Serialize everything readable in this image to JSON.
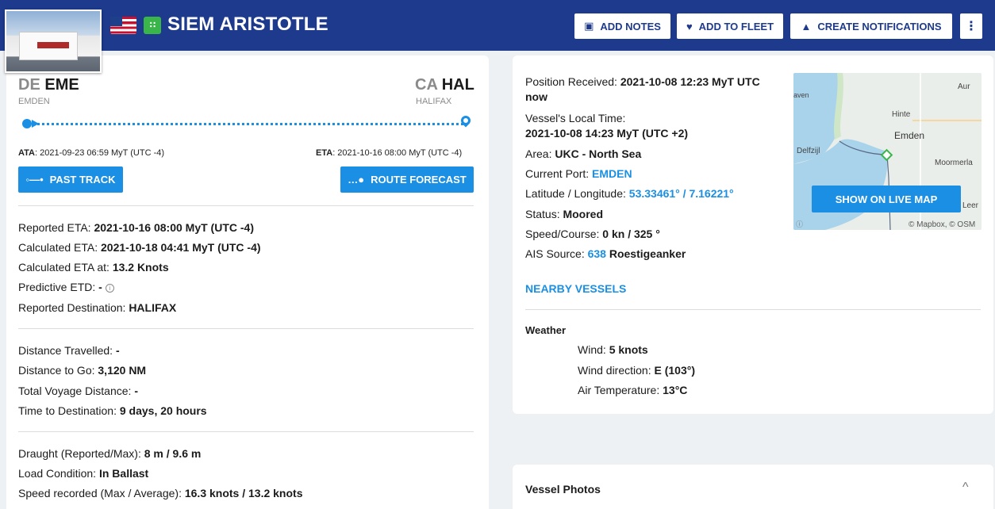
{
  "header": {
    "vessel_name": "SIEM ARISTOTLE",
    "flag_icon": "us-flag-icon",
    "type_icon": "cargo-vessel-icon",
    "buttons": {
      "add_notes": "ADD NOTES",
      "add_to_fleet": "ADD TO FLEET",
      "create_notifications": "CREATE NOTIFICATIONS"
    },
    "more_icon": "⋮",
    "color": "#1d3a8c"
  },
  "voyage": {
    "origin": {
      "country": "DE",
      "code": "EME",
      "name": "EMDEN"
    },
    "destination": {
      "country": "CA",
      "code": "HAL",
      "name": "HALIFAX"
    },
    "ata_label": "ATA",
    "ata_value": ": 2021-09-23 06:59 MyT (UTC -4)",
    "eta_label": "ETA",
    "eta_value": ": 2021-10-16 08:00 MyT (UTC -4)",
    "past_track_label": "PAST TRACK",
    "route_forecast_label": "ROUTE FORECAST",
    "accent": "#1a8fe3"
  },
  "eta_info": {
    "reported_eta": {
      "label": "Reported ETA: ",
      "value": "2021-10-16 08:00 MyT (UTC -4)"
    },
    "calculated_eta": {
      "label": "Calculated ETA: ",
      "value": "2021-10-18 04:41 MyT (UTC -4)"
    },
    "calculated_eta_at": {
      "label": "Calculated ETA at: ",
      "value": "13.2 Knots"
    },
    "predictive_etd": {
      "label": "Predictive ETD: ",
      "value": "-"
    },
    "reported_destination": {
      "label": "Reported Destination: ",
      "value": "HALIFAX"
    }
  },
  "distance_info": {
    "distance_travelled": {
      "label": "Distance Travelled: ",
      "value": "-"
    },
    "distance_to_go": {
      "label": "Distance to Go: ",
      "value": "3,120 NM"
    },
    "total_voyage_distance": {
      "label": "Total Voyage Distance: ",
      "value": "-"
    },
    "time_to_destination": {
      "label": "Time to Destination: ",
      "value": "9 days, 20 hours"
    }
  },
  "condition_info": {
    "draught": {
      "label": "Draught (Reported/Max): ",
      "value": "8 m / 9.6 m"
    },
    "load_condition": {
      "label": "Load Condition: ",
      "value": "In Ballast"
    },
    "speed_recorded": {
      "label": "Speed recorded (Max / Average): ",
      "value": "16.3 knots / 13.2 knots"
    }
  },
  "position": {
    "position_received": {
      "label": "Position Received: ",
      "value": "2021-10-08 12:23 MyT UTC",
      "value2": "now"
    },
    "local_time": {
      "label": "Vessel's Local Time:",
      "value": "2021-10-08 14:23 MyT (UTC +2)"
    },
    "area": {
      "label": "Area: ",
      "value": "UKC - North Sea"
    },
    "current_port": {
      "label": "Current Port: ",
      "value": "EMDEN"
    },
    "lat_lon": {
      "label": "Latitude / Longitude: ",
      "value": "53.33461° / 7.16221°"
    },
    "status": {
      "label": "Status: ",
      "value": "Moored"
    },
    "speed_course": {
      "label": "Speed/Course: ",
      "value": "0 kn / 325 °"
    },
    "ais_source": {
      "label": "AIS Source: ",
      "id": "638",
      "name": "Roestigeanker"
    }
  },
  "map": {
    "labels": [
      "Aur",
      "aven",
      "Hinte",
      "Emden",
      "Delfzijl",
      "Moormerla",
      "Leer"
    ],
    "attribution": "© Mapbox, © OSM",
    "attribution_icon": "ⓘ",
    "button": "SHOW ON LIVE MAP"
  },
  "nearby_vessels": "NEARBY VESSELS",
  "weather": {
    "heading": "Weather",
    "wind": {
      "label": "Wind: ",
      "value": "5 knots"
    },
    "wind_direction": {
      "label": "Wind direction: ",
      "value": "E (103°)"
    },
    "air_temperature": {
      "label": "Air Temperature: ",
      "value": "13°C"
    }
  },
  "vessel_photos": {
    "title": "Vessel Photos",
    "caret": "^"
  }
}
